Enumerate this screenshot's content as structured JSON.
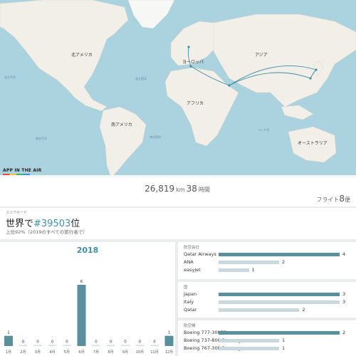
{
  "map": {
    "labels": {
      "north_america": "北アメリカ",
      "europe": "ヨーロッパ",
      "asia": "アジア",
      "africa": "アフリカ",
      "south_america": "南アメリカ",
      "oceania": "オーストラリア",
      "north_pacific": "北太平洋",
      "north_atlantic": "北大西洋",
      "south_atlantic": "南大西洋",
      "south_pacific": "南太平洋",
      "indian_ocean": "インド洋"
    },
    "brand": "APP IN THE AIR",
    "route_color": "#3f8fa3"
  },
  "stats": {
    "distance": "26,819",
    "distance_unit": "km",
    "hours": "38",
    "hours_unit": "時間",
    "flights_prefix": "フライト",
    "flights_count": "8",
    "flights_suffix": "便"
  },
  "scoreboard": {
    "label": "スコアボード",
    "rank_prefix": "世界で",
    "rank_number": "#39503",
    "rank_suffix": "位",
    "subtitle": "上位92%（2019のすべての旅行者で）"
  },
  "chart_data": {
    "type": "bar",
    "title": "2018",
    "categories": [
      "1月",
      "2月",
      "3月",
      "4月",
      "5月",
      "6月",
      "7月",
      "8月",
      "9月",
      "10月",
      "11月",
      "12月"
    ],
    "values": [
      1,
      0,
      0,
      0,
      0,
      6,
      0,
      0,
      0,
      0,
      0,
      1
    ],
    "ylim": [
      0,
      6
    ],
    "bar_color": "#5a8f9c",
    "empty_color": "#d4dee2"
  },
  "airlines": {
    "title": "航空会社",
    "max": 4,
    "items": [
      {
        "name": "Qatar Airways",
        "value": 4
      },
      {
        "name": "ANA",
        "value": 2
      },
      {
        "name": "easyJet",
        "value": 1
      }
    ]
  },
  "countries": {
    "title": "国",
    "max": 3,
    "items": [
      {
        "name": "Japan",
        "value": 3
      },
      {
        "name": "Italy",
        "value": 3
      },
      {
        "name": "Qatar",
        "value": 2
      }
    ]
  },
  "aircraft": {
    "title": "航空機",
    "max": 2,
    "items": [
      {
        "name": "Boeing 777-300ER",
        "value": 2
      },
      {
        "name": "Boeing 737-800 Passenger",
        "value": 1
      },
      {
        "name": "Boeing 767-300 Passenger",
        "value": 1
      }
    ]
  },
  "colors": {
    "accent": "#3f8fa3",
    "top_bar": "#5a8f9c",
    "light_bar": "#c7d9de"
  }
}
